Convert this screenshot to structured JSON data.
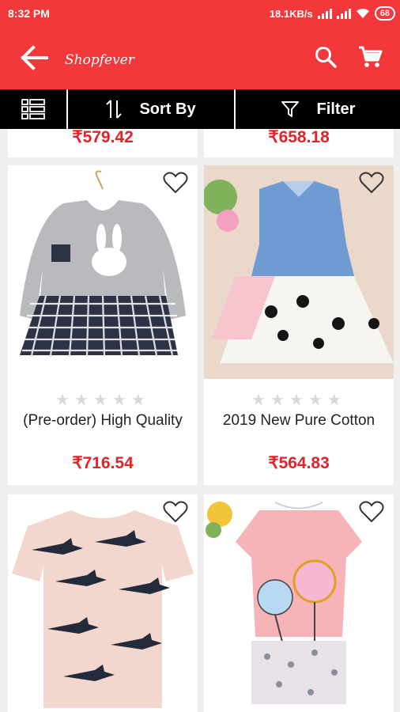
{
  "status_bar": {
    "time": "8:32 PM",
    "network_speed": "18.1KB/s",
    "battery": "68"
  },
  "app_bar": {
    "title": "Shopfever",
    "back_icon": "arrow-back-icon",
    "search_icon": "search-icon",
    "cart_icon": "cart-icon"
  },
  "toolbar": {
    "sort_label": "Sort By",
    "filter_label": "Filter"
  },
  "colors": {
    "accent": "#f2383a",
    "price": "#e2232a",
    "toolbar": "#000000"
  },
  "products_partial": [
    {
      "price": "₹579.42"
    },
    {
      "price": "₹658.18"
    }
  ],
  "products": [
    {
      "name": "(Pre-order) High Quality",
      "price": "₹716.54",
      "rating": 0
    },
    {
      "name": "2019 New Pure Cotton",
      "price": "₹564.83",
      "rating": 0
    },
    {
      "name": "",
      "price": "",
      "rating": 0
    },
    {
      "name": "",
      "price": "",
      "rating": 0
    }
  ],
  "stars_text": "★★★★★"
}
